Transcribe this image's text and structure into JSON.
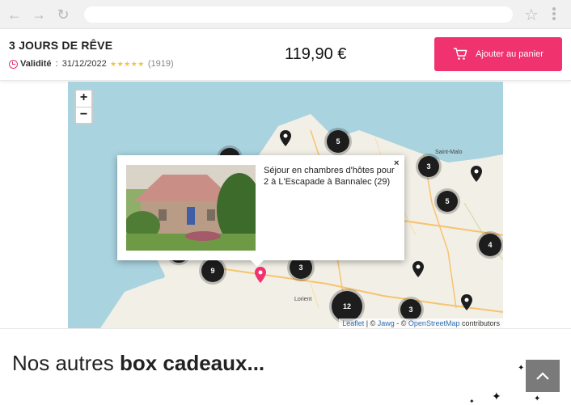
{
  "browser": {
    "back_icon": "arrow-left-icon",
    "forward_icon": "arrow-right-icon",
    "reload_icon": "reload-icon",
    "bookmark_icon": "star-icon",
    "menu_icon": "kebab-menu-icon"
  },
  "product": {
    "title": "3 JOURS DE RÊVE",
    "validity_label": "Validité",
    "validity_sep": " : ",
    "validity_date": "31/12/2022",
    "stars": "★★★★★",
    "review_count": "(1919)",
    "price": "119,90 €",
    "cart_button": "Ajouter au panier",
    "accent_color": "#f0326e"
  },
  "map": {
    "zoom_in": "+",
    "zoom_out": "−",
    "clusters": [
      "5",
      "3",
      "5",
      "4",
      "9",
      "3",
      "12",
      "3"
    ],
    "cities": [
      "Saint-Malo",
      "Lorient"
    ],
    "attribution": {
      "leaflet": "Leaflet",
      "sep1": " | © ",
      "jawg": "Jawg",
      "sep2": " - © ",
      "osm": "OpenStreetMap",
      "suffix": " contributors"
    }
  },
  "popup": {
    "close": "×",
    "text": "Séjour en chambres d'hôtes pour 2 à L'Escapade à Bannalec (29)"
  },
  "section": {
    "title_regular": "Nos autres ",
    "title_bold": "box cadeaux..."
  },
  "scroll_top_icon": "chevron-up-icon"
}
